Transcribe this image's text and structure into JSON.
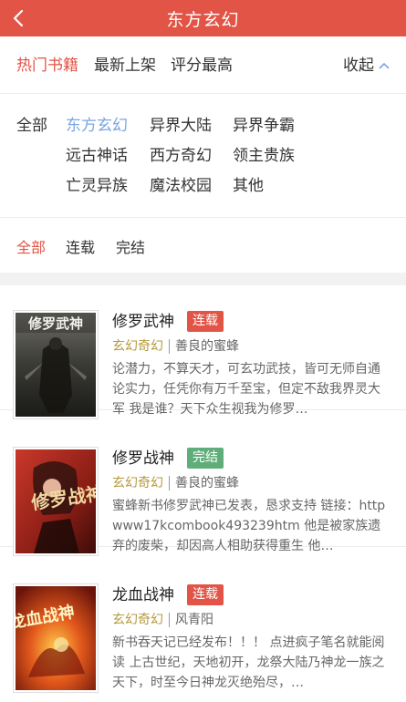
{
  "header": {
    "title": "东方玄幻",
    "back_icon": "chevron-left-icon"
  },
  "sort_tabs": {
    "items": [
      "热门书籍",
      "最新上架",
      "评分最高"
    ],
    "collapse_label": "收起"
  },
  "genres": {
    "items": [
      "全部",
      "东方玄幻",
      "异界大陆",
      "异界争霸",
      "远古神话",
      "西方奇幻",
      "领主贵族",
      "亡灵异族",
      "魔法校园",
      "其他"
    ]
  },
  "status_tabs": {
    "items": [
      "全部",
      "连载",
      "完结"
    ]
  },
  "colors": {
    "accent": "#e25446",
    "genre_selected": "#7aa6e0",
    "done_badge": "#5fae7a",
    "category": "#b59a3c"
  },
  "books": [
    {
      "title": "修罗武神",
      "status": "连载",
      "category": "玄幻奇幻",
      "author": "善良的蜜蜂",
      "desc": "论潜力，不算天才，可玄功武技，皆可无师自通 论实力，任凭你有万千至宝，但定不敌我界灵大军 我是谁？天下众生视我为修罗…",
      "cover_text": "修罗武神"
    },
    {
      "title": "修罗战神",
      "status": "完结",
      "category": "玄幻奇幻",
      "author": "善良的蜜蜂",
      "desc": "蜜蜂新书修罗武神已发表，恳求支持 链接：httpwww17kcombook493239htm 他是被家族遗弃的废柴，却因高人相助获得重生 他…",
      "cover_text": "修罗战神"
    },
    {
      "title": "龙血战神",
      "status": "连载",
      "category": "玄幻奇幻",
      "author": "风青阳",
      "desc": "新书吞天记已经发布！！！ 点进疯子笔名就能阅读 上古世纪，天地初开，龙祭大陆乃神龙一族之天下，时至今日神龙灭绝殆尽，…",
      "cover_text": "龙血战神"
    }
  ]
}
